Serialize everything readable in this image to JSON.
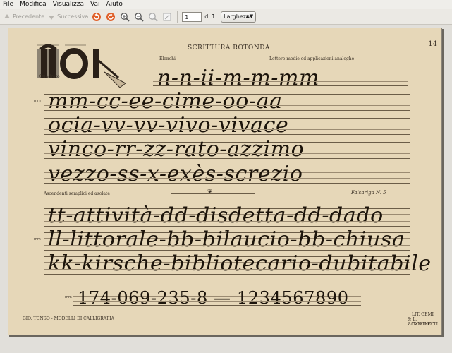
{
  "menu": [
    "File",
    "Modifica",
    "Visualizza",
    "Vai",
    "Aiuto"
  ],
  "toolbar": {
    "prev_label": "Precedente",
    "next_label": "Successiva",
    "page_value": "1",
    "of_text": "di 1",
    "zoom_value": "Larghezza"
  },
  "document": {
    "page_number": "14",
    "title": "SCRITTURA ROTONDA",
    "label_left": "Quadrato",
    "label_elenco": "Elenchi",
    "label_lettere": "Lettere medie ed applicazioni analoghe",
    "label_ascendenti": "Ascendenti semplici ed asolate",
    "label_falsariga": "Falsariga N. 5",
    "footer_left": "GIO. TONSO - MODELLI DI CALLIGRAFIA",
    "footer_right_1": "LIT. GEMI",
    "footer_right_2": "& L. ZAMBOLETTI",
    "footer_right_3": "TORINO",
    "mm_label": "mm",
    "lines": [
      "n-n-ii-m-m-mm",
      "mm-cc-ee-cime-oo-aa",
      "ocia-vv-vv-vivo-vivace",
      "vinco-rr-zz-rato-azzimo",
      "vezzo-ss-x-exès-screzio",
      "tt-attività-dd-disdetta-dd-dado",
      "ll-littorale-bb-bilaucio-bb-chiusa",
      "kk-kirsche-bibliotecario-dubitabile",
      "174-069-235-8 — 1234567890"
    ]
  }
}
